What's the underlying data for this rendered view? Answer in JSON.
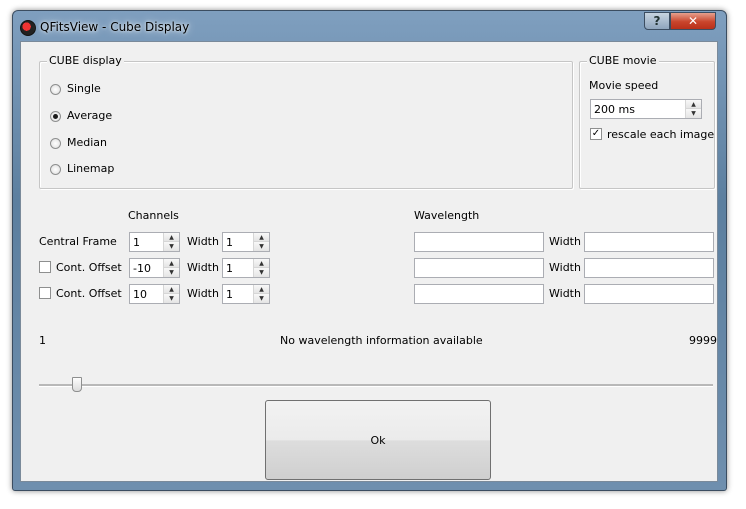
{
  "window": {
    "title": "QFitsView - Cube Display",
    "help_label": "?",
    "close_label": "✕"
  },
  "cube_display": {
    "label": "CUBE display",
    "options": [
      {
        "label": "Single",
        "selected": false
      },
      {
        "label": "Average",
        "selected": true
      },
      {
        "label": "Median",
        "selected": false
      },
      {
        "label": "Linemap",
        "selected": false
      }
    ]
  },
  "cube_movie": {
    "label": "CUBE movie",
    "speed_label": "Movie speed",
    "speed_value": "200 ms",
    "rescale_label": "rescale each image",
    "rescale_checked": true
  },
  "channels": {
    "header": "Channels",
    "central_frame_label": "Central Frame",
    "central_frame_value": "1",
    "central_width_label": "Width",
    "central_width_value": "1",
    "offset1_label": "Cont. Offset",
    "offset1_value": "-10",
    "offset1_width_label": "Width",
    "offset1_width_value": "1",
    "offset2_label": "Cont. Offset",
    "offset2_value": "10",
    "offset2_width_label": "Width",
    "offset2_width_value": "1"
  },
  "wavelength": {
    "header": "Wavelength",
    "width_label_1": "Width",
    "width_label_2": "Width",
    "width_label_3": "Width"
  },
  "range": {
    "min_label": "1",
    "info": "No wavelength information available",
    "max_label": "9999",
    "slider_position": 0.05
  },
  "ok_label": "Ok",
  "icons": {
    "up": "▲",
    "down": "▼",
    "check": "✓"
  }
}
